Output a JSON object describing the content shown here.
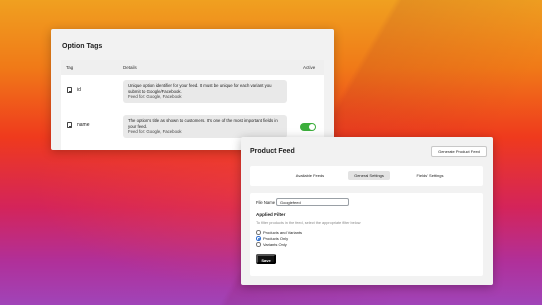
{
  "option_tags": {
    "title": "Option Tags",
    "columns": {
      "tag": "Tag",
      "details": "Details",
      "active": "Active"
    },
    "rows": [
      {
        "tag": "id",
        "icon": "document-icon",
        "detail": "Unique option identifier for your feed. It must be unique for each variant you submit to Google/Facebook.",
        "feed": "Feed for: Google, Facebook",
        "active": null
      },
      {
        "tag": "name",
        "icon": "document-icon",
        "detail": "The option's title as shown to customers. It's one of the most important fields in your feed.",
        "feed": "Feed for: Google, Facebook",
        "active": true
      }
    ],
    "toggle_color": "#3cae3c"
  },
  "product_feed": {
    "title": "Product Feed",
    "generate_button": "Generate Product Feed",
    "tabs": [
      {
        "label": "Available Feeds",
        "active": false
      },
      {
        "label": "General Settings",
        "active": true
      },
      {
        "label": "Fields' Settings",
        "active": false
      }
    ],
    "file_name_label": "File Name",
    "file_name_value": "Googlefeed",
    "applied_filter_title": "Applied Filter",
    "applied_filter_hint": "To filter products in the feed, select the appropriate filter below",
    "filter_options": [
      {
        "label": "Products and Variants",
        "checked": false
      },
      {
        "label": "Products Only",
        "checked": true
      },
      {
        "label": "Variants Only",
        "checked": false
      }
    ],
    "save_button": "Save",
    "accent_color": "#2f6fd0"
  }
}
